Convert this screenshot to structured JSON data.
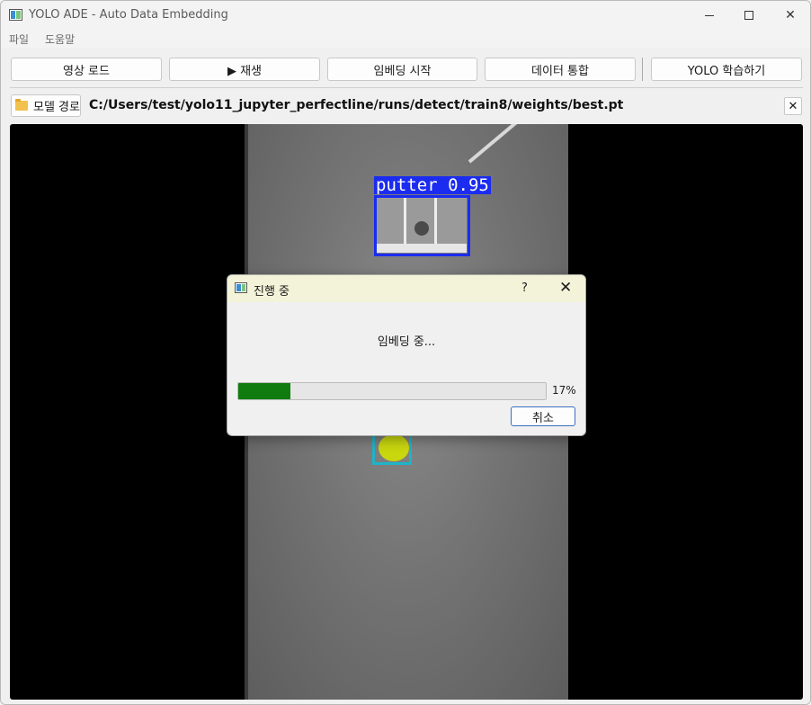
{
  "window": {
    "title": "YOLO ADE - Auto Data Embedding",
    "minimize_glyph": "—",
    "maximize_glyph": "☐",
    "close_glyph": "✕"
  },
  "menu": {
    "items": [
      "파일",
      "도움말"
    ]
  },
  "toolbar": {
    "load_video": "영상 로드",
    "play": "▶ 재생",
    "start_embedding": "임베딩 시작",
    "merge_data": "데이터 통합",
    "yolo_train": "YOLO 학습하기"
  },
  "model": {
    "button_label": "모델 경로",
    "path": "C:/Users/test/yolo11_jupyter_perfectline/runs/detect/train8/weights/best.pt",
    "clear_glyph": "✕"
  },
  "video": {
    "detections": [
      {
        "label": "putter 0.95",
        "color": "#1b2cf0"
      }
    ]
  },
  "dialog": {
    "title": "진행 중",
    "help_glyph": "?",
    "close_glyph": "✕",
    "message": "임베딩 중...",
    "progress_percent": 17,
    "progress_text": "17%",
    "cancel_label": "취소"
  },
  "colors": {
    "progress_fill": "#107c10",
    "detection_putter": "#1b2cf0",
    "detection_ball": "#1fb4c8"
  }
}
